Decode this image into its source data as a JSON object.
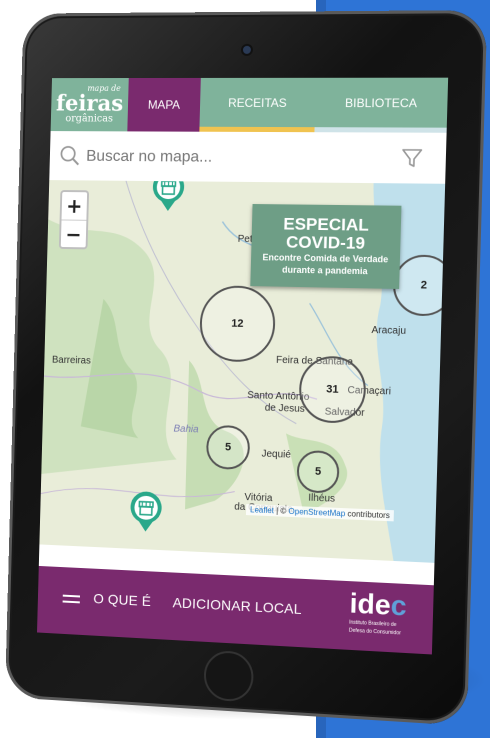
{
  "colors": {
    "background_blue": "#2e74d6",
    "nav_green": "#7fb39b",
    "nav_purple": "#7a2a6e",
    "tab_receitas_accent": "#f0c350",
    "tab_biblioteca_accent": "#cfe3e8",
    "banner_green": "#6e9e86",
    "pin_teal": "#2aa88a"
  },
  "header": {
    "logo": {
      "small": "mapa de",
      "main": "feiras",
      "sub": "orgânicas"
    },
    "tabs": [
      {
        "label": "MAPA",
        "active": true
      },
      {
        "label": "RECEITAS",
        "active": false
      },
      {
        "label": "BIBLIOTECA",
        "active": false
      }
    ]
  },
  "search": {
    "placeholder": "Buscar no mapa...",
    "icon": "search-icon",
    "filter_icon": "filter-icon"
  },
  "map": {
    "zoom_in": "+",
    "zoom_out": "−",
    "places": [
      "Petr",
      "Aracaju",
      "Barreiras",
      "Feira de Santana",
      "Santo Antônio",
      "de Jesus",
      "Camaçari",
      "Salvador",
      "Bahia",
      "Jequié",
      "Ilhéus",
      "Vitória",
      "da Conquista"
    ],
    "clusters": [
      "12",
      "31",
      "5",
      "5",
      "2"
    ],
    "pins": [
      "market-stall-icon",
      "market-stall-icon"
    ],
    "banner": {
      "title": "ESPECIAL COVID-19",
      "line1": "Encontre Comida de Verdade",
      "line2": "durante a pandemia"
    },
    "attribution": {
      "leaflet": "Leaflet",
      "sep": " | © ",
      "osm": "OpenStreetMap",
      "suffix": " contributors"
    }
  },
  "bottom_nav": {
    "menu_icon": "hamburger-icon",
    "items": [
      "O QUE É",
      "ADICIONAR LOCAL"
    ],
    "idec": {
      "word_main": "ide",
      "word_c": "c",
      "sub1": "Instituto Brasileiro de",
      "sub2": "Defesa do Consumidor"
    }
  }
}
